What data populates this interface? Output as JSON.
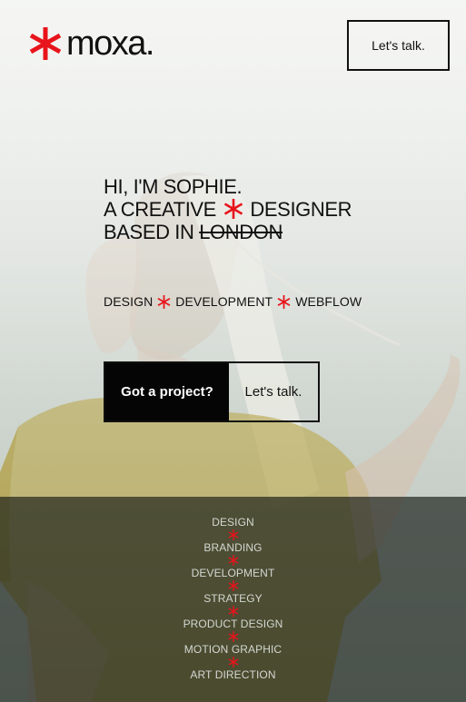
{
  "brand": {
    "name": "moxa.",
    "accent_color": "#e8141b"
  },
  "nav": {
    "cta_label": "Let's talk."
  },
  "hero": {
    "line1": "HI, I'M SOPHIE.",
    "line2_before": "A CREATIVE",
    "line2_after": "DESIGNER",
    "line3_before": "BASED IN",
    "line3_struck": "LONDON",
    "services": [
      "DESIGN",
      "DEVELOPMENT",
      "WEBFLOW"
    ],
    "cta_primary": "Got a project?",
    "cta_secondary": "Let's talk."
  },
  "skills": [
    "DESIGN",
    "BRANDING",
    "DEVELOPMENT",
    "STRATEGY",
    "PRODUCT DESIGN",
    "MOTION GRAPHIC",
    "ART DIRECTION"
  ],
  "icons": {
    "separator": "asterisk-icon"
  }
}
